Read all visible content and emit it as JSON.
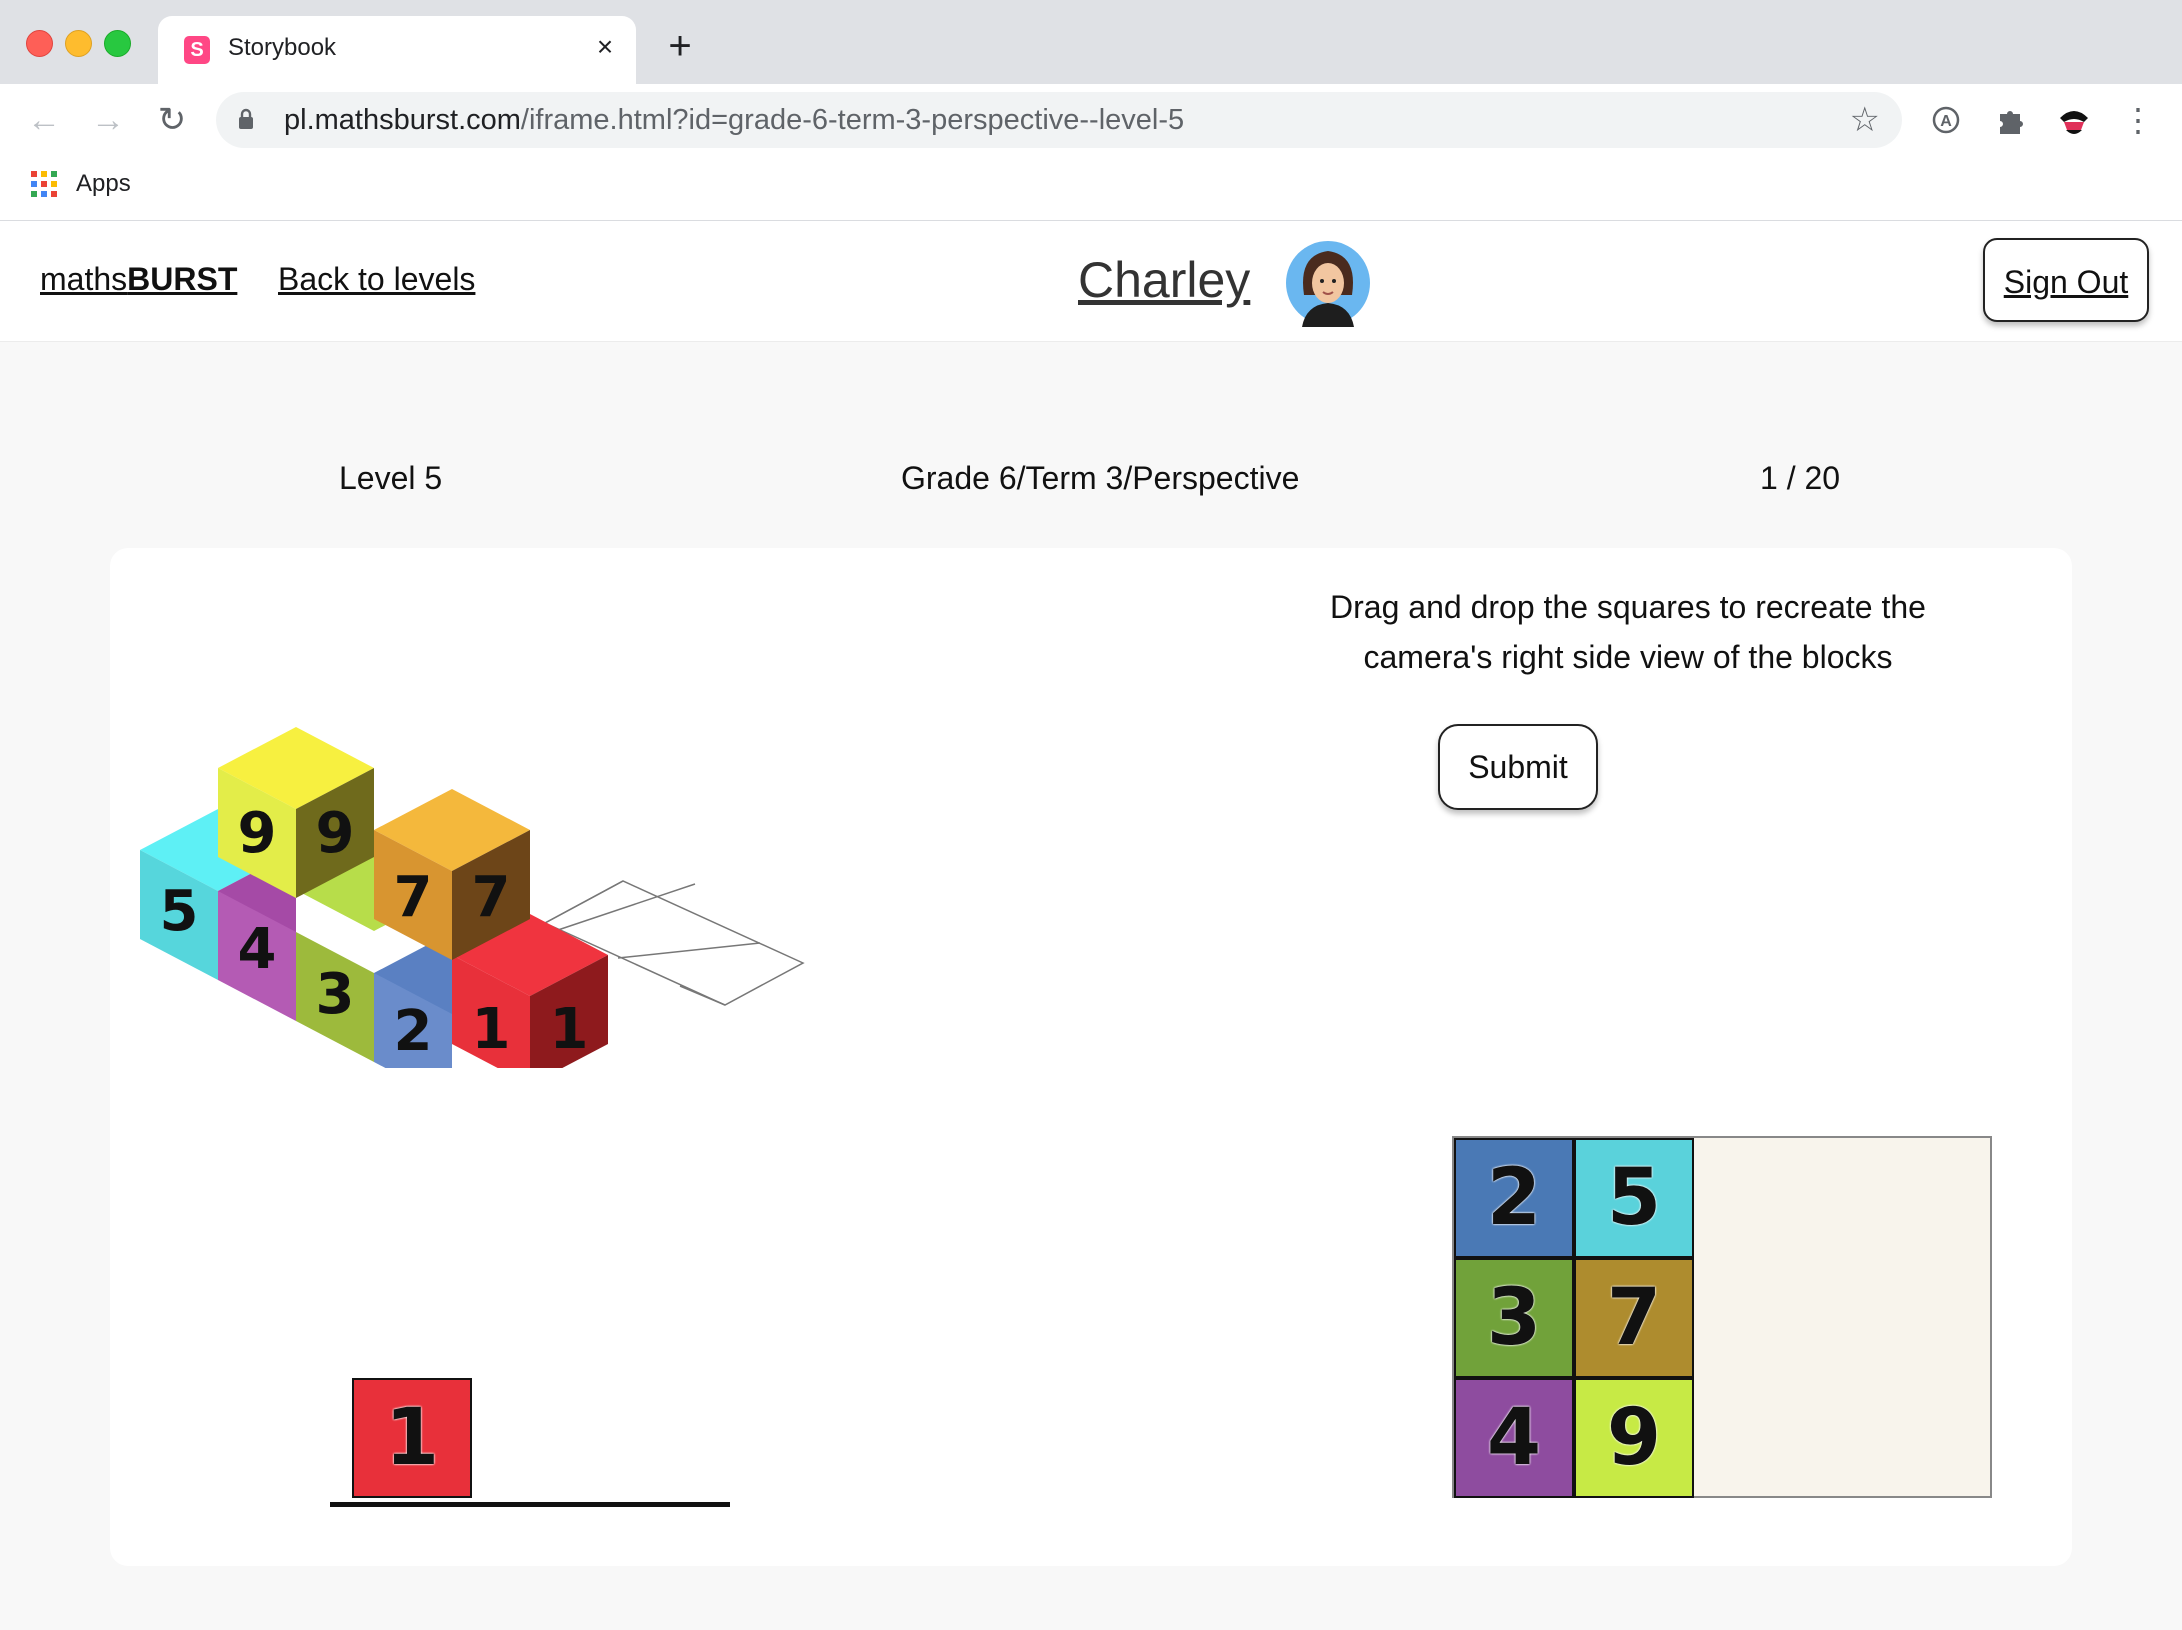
{
  "browser": {
    "tab_title": "Storybook",
    "tab_favicon": "S",
    "url_host": "pl.mathsburst.com",
    "url_rest": "/iframe.html?id=grade-6-term-3-perspective--level-5",
    "bookmark_apps": "Apps"
  },
  "header": {
    "brand_light": "maths",
    "brand_bold": "BURST",
    "back_link": "Back to levels",
    "username": "Charley",
    "signout": "Sign Out"
  },
  "info": {
    "level": "Level 5",
    "path": "Grade 6/Term 3/Perspective",
    "progress": "1 / 20"
  },
  "task": {
    "instructions_line1": "Drag and drop the squares to recreate the",
    "instructions_line2": "camera's right side view of the blocks",
    "submit": "Submit"
  },
  "iso_blocks": {
    "labels": [
      "5",
      "4",
      "3",
      "2",
      "1",
      "9",
      "7"
    ]
  },
  "drop_zone": {
    "placed": [
      {
        "label": "1",
        "color": "#e8303a"
      }
    ]
  },
  "palette": {
    "tiles": [
      {
        "label": "2",
        "color": "#4a79b5"
      },
      {
        "label": "5",
        "color": "#5ad2db"
      },
      {
        "label": "3",
        "color": "#71a23a"
      },
      {
        "label": "7",
        "color": "#ae8c2e"
      },
      {
        "label": "4",
        "color": "#8e4c9f"
      },
      {
        "label": "9",
        "color": "#c7ea45"
      }
    ]
  }
}
